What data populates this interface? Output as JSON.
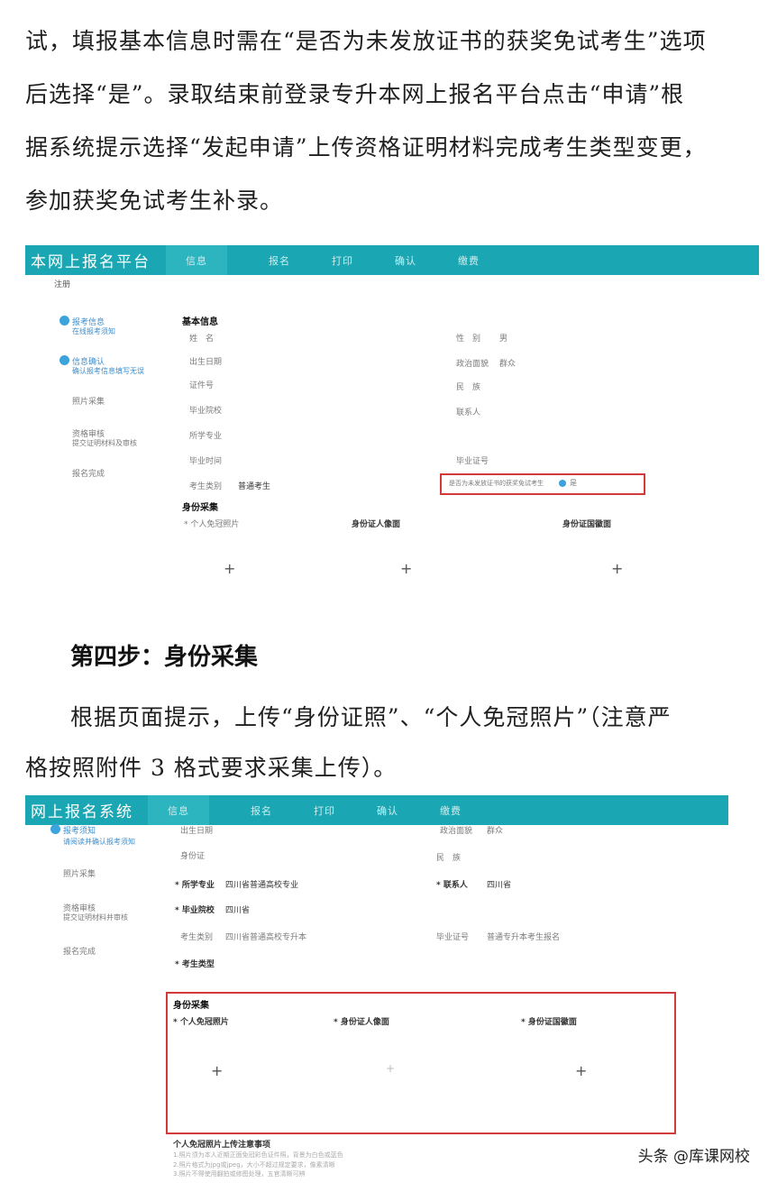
{
  "intro_lines": [
    "试，填报基本信息时需在“是否为未发放证书的获奖免试考生”选项",
    "后选择“是”。录取结束前登录专升本网上报名平台点击“申请”根",
    "据系统提示选择“发起申请”上传资格证明材料完成考生类型变更，",
    "参加获奖免试考生补录。"
  ],
  "shot1": {
    "title": "本网上报名平台",
    "tabs": [
      "信息",
      "报名",
      "打印",
      "确认",
      "缴费"
    ],
    "breadcrumb": "注册",
    "side": [
      {
        "t": "报考信息",
        "s": "在线报考须知"
      },
      {
        "t": "信息确认",
        "s": "确认报考信息填写无误"
      },
      {
        "t": "照片采集",
        "s": ""
      },
      {
        "t": "资格审核",
        "s": "提交证明材料及审核"
      },
      {
        "t": "报名完成",
        "s": ""
      }
    ],
    "section1": "基本信息",
    "section2": "身份采集",
    "left_fields": [
      "姓　名",
      "出生日期",
      "证件号",
      "毕业院校",
      "所学专业",
      "毕业时间",
      "考生类别"
    ],
    "left_values": [
      "",
      "",
      "",
      "",
      "",
      "",
      "普通考生"
    ],
    "right_fields": [
      "性　别",
      "政治面貌",
      "民　族",
      "联系人",
      "毕业证号",
      "是否为未发放证书的获奖免试考生"
    ],
    "right_values": [
      "男",
      "群众",
      "",
      "",
      "",
      "是"
    ],
    "upload_labels": [
      "* 个人免冠照片",
      "身份证人像面",
      "身份证国徽面"
    ]
  },
  "heading": "第四步：身份采集",
  "step4_lines": [
    "根据页面提示，上传“身份证照”、“个人免冠照片”（注意严",
    "格按照附件 3 格式要求采集上传）。"
  ],
  "shot2": {
    "title": "网上报名系统",
    "tabs": [
      "信息",
      "报名",
      "打印",
      "确认",
      "缴费"
    ],
    "side": [
      {
        "t": "报考须知",
        "s": "请阅读并确认报考须知"
      },
      {
        "t": "照片采集",
        "s": ""
      },
      {
        "t": "资格审核",
        "s": "提交证明材料并审核"
      },
      {
        "t": "报名完成",
        "s": ""
      }
    ],
    "left_fields": [
      "出生日期",
      "身份证",
      "* 所学专业",
      "* 毕业院校",
      "考生类别",
      "* 考生类型"
    ],
    "left_values": [
      "",
      "",
      "四川省普通高校专业",
      "四川省",
      "四川省普通高校专升本",
      ""
    ],
    "right_fields": [
      "政治面貌",
      "民　族",
      "* 联系人",
      "毕业证号"
    ],
    "right_values": [
      "群众",
      "",
      "四川省",
      "普通专升本考生报名"
    ],
    "section": "身份采集",
    "upload_labels": [
      "* 个人免冠照片",
      "* 身份证人像面",
      "* 身份证国徽面"
    ],
    "footer_title": "个人免冠照片上传注意事项",
    "footer_lines": [
      "1.照片须为本人近期正面免冠彩色证件照，背景为白色或蓝色",
      "2.照片格式为jpg或jpeg，大小不超过规定要求，像素清晰",
      "3.照片不得使用翻拍或修图处理，五官清晰可辨"
    ]
  },
  "watermark": "头条 @库课网校"
}
